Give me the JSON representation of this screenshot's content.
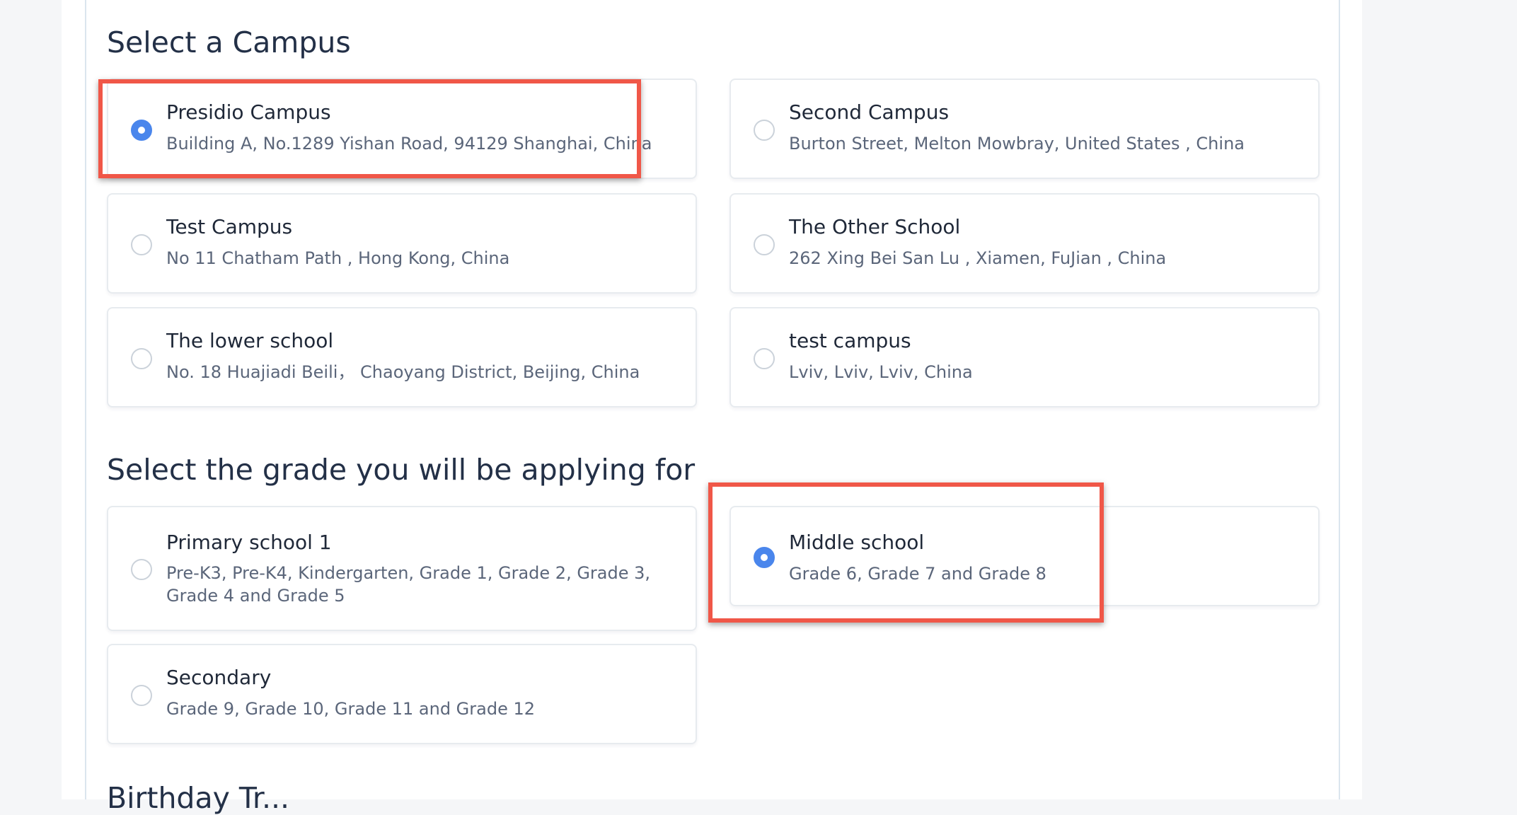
{
  "campus_section": {
    "title": "Select a Campus",
    "options": [
      {
        "name": "Presidio Campus",
        "address": "Building A, No.1289 Yishan Road, 94129 Shanghai, China",
        "selected": true
      },
      {
        "name": "Second Campus",
        "address": "Burton Street, Melton Mowbray, United States , China",
        "selected": false
      },
      {
        "name": "Test Campus",
        "address": "No 11 Chatham Path , Hong Kong, China",
        "selected": false
      },
      {
        "name": "The Other School",
        "address": "262 Xing Bei San Lu , Xiamen, FuJian , China",
        "selected": false
      },
      {
        "name": "The lower school",
        "address": "No. 18 Huajiadi Beili，  Chaoyang District, Beijing, China",
        "selected": false
      },
      {
        "name": "test campus",
        "address": "Lviv, Lviv, Lviv, China",
        "selected": false
      }
    ]
  },
  "grade_section": {
    "title": "Select the grade you will be applying for",
    "options": [
      {
        "name": "Primary school 1",
        "grades": "Pre-K3, Pre-K4, Kindergarten, Grade 1, Grade 2, Grade 3, Grade 4 and Grade 5",
        "selected": false
      },
      {
        "name": "Middle school",
        "grades": "Grade 6, Grade 7 and Grade 8",
        "selected": true
      },
      {
        "name": "Secondary",
        "grades": "Grade 9, Grade 10, Grade 11 and Grade 12",
        "selected": false
      }
    ]
  },
  "next_section": {
    "title_partial": "Birthday Tr..."
  },
  "colors": {
    "selected_radio": "#4a86ec",
    "highlight": "#f05748",
    "title_text": "#233047",
    "desc_text": "#5b667a"
  }
}
